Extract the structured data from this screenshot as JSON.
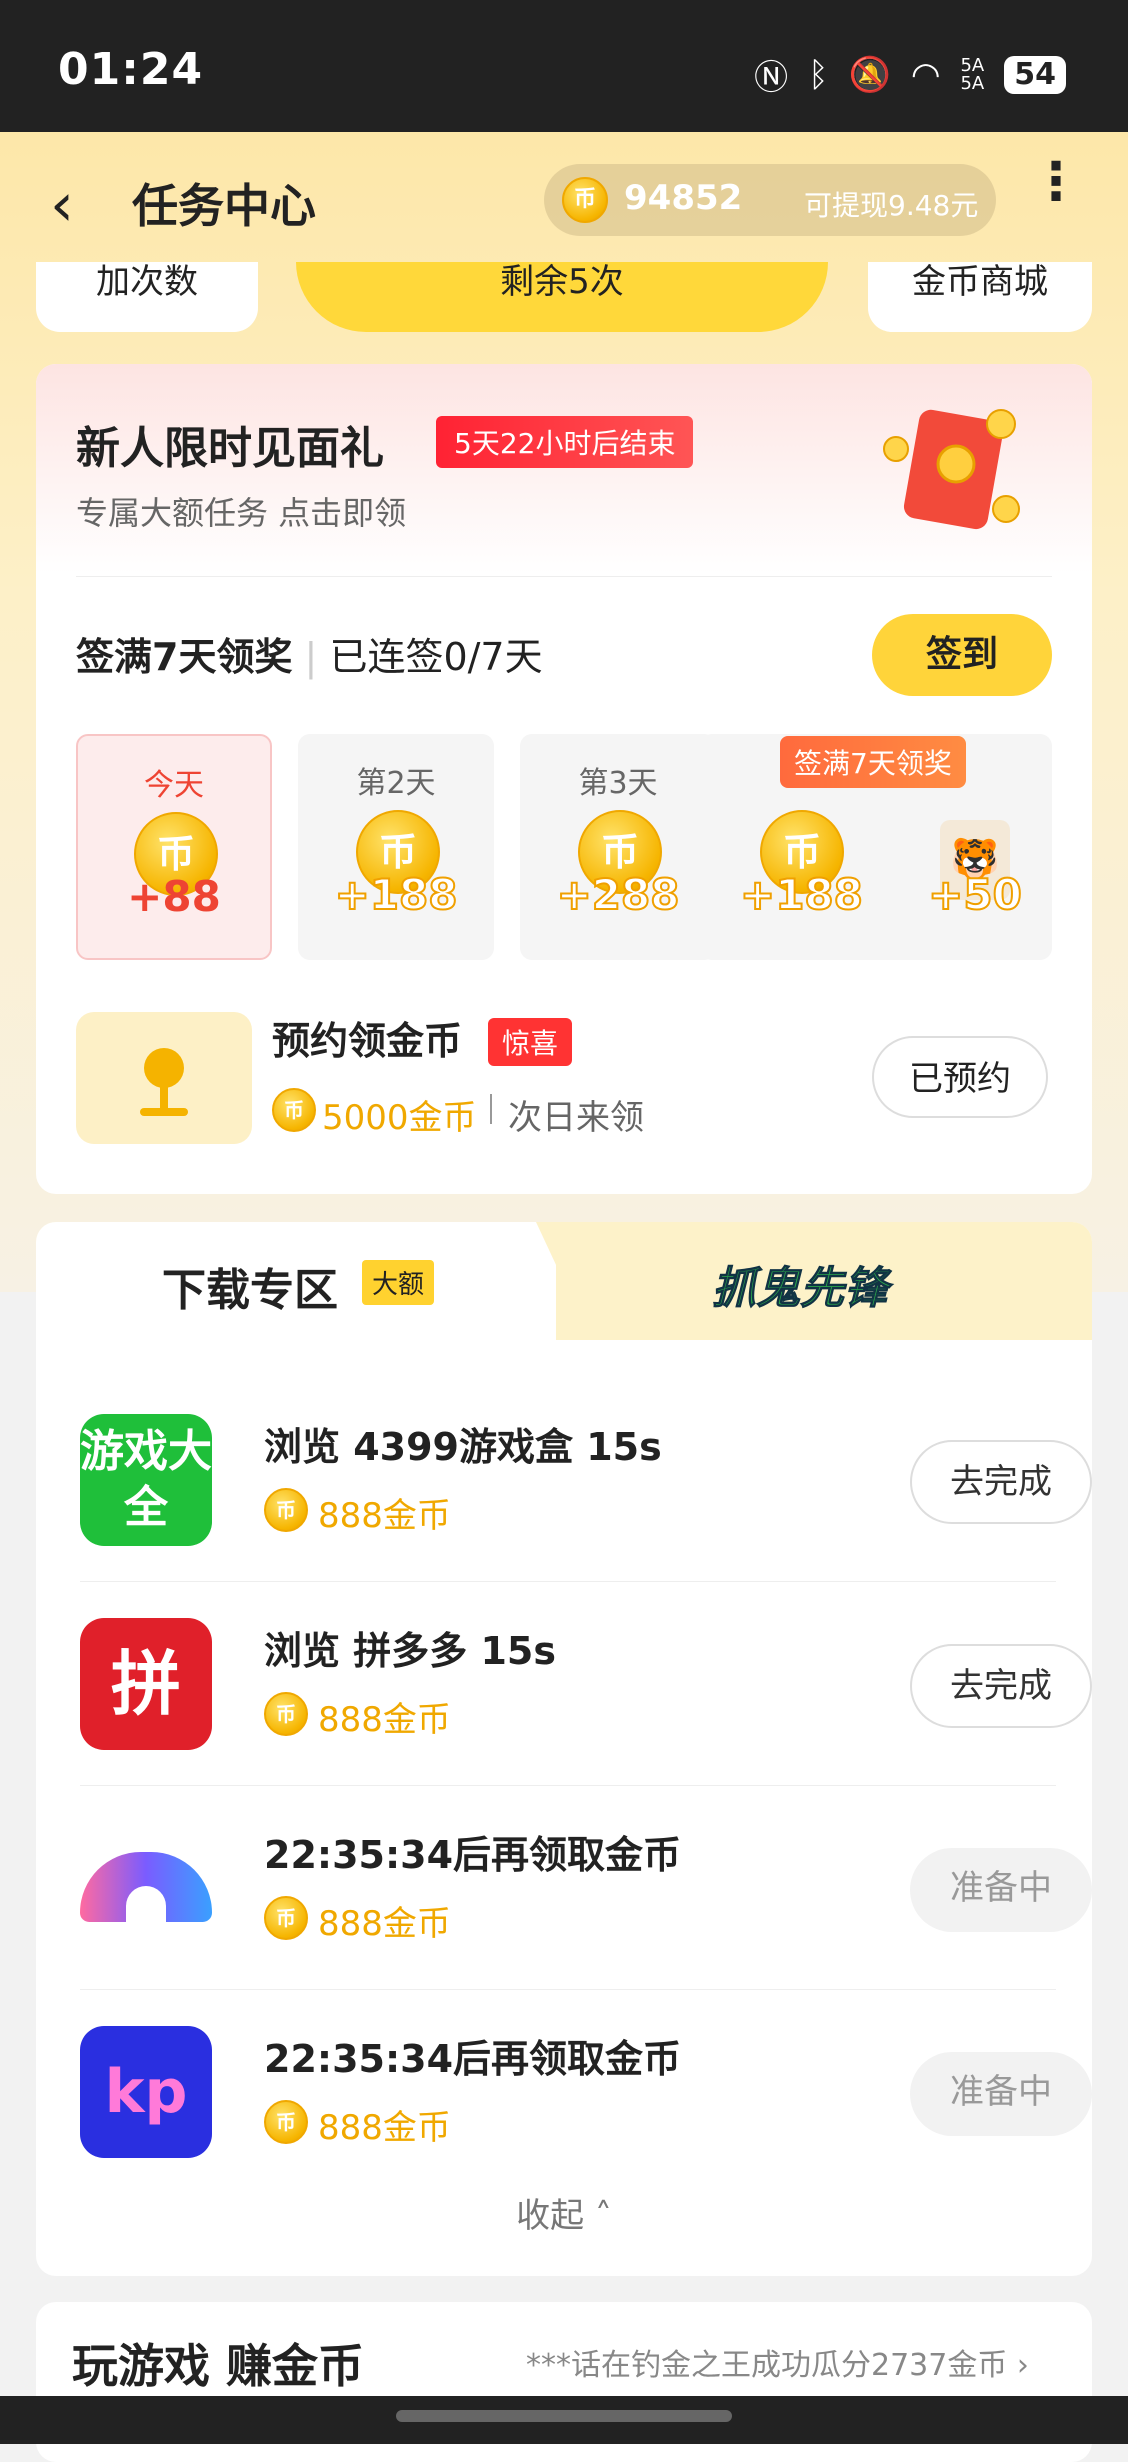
{
  "status_bar": {
    "time": "01:24",
    "icons": [
      "nfc-icon",
      "bluetooth-icon",
      "mute-icon",
      "wifi-icon",
      "signal-icon"
    ],
    "net": "5A",
    "battery": "54"
  },
  "header": {
    "title": "任务中心",
    "coins": "94852",
    "withdraw": "可提现9.48元"
  },
  "strip": {
    "left": "加次数",
    "middle": "剩余5次",
    "right": "金币商城"
  },
  "gift": {
    "title": "新人限时见面礼",
    "badge": "5天22小时后结束",
    "subtitle": "专属大额任务 点击即领"
  },
  "signin": {
    "title": "签满7天领奖",
    "progress": "已连签0/7天",
    "button": "签到",
    "days": [
      {
        "label": "今天",
        "amount": "+88"
      },
      {
        "label": "第2天",
        "amount": "+188"
      },
      {
        "label": "第3天",
        "amount": "+288"
      },
      {
        "label": "签满7天领奖",
        "amount": "+188",
        "bonus": "+50"
      }
    ]
  },
  "reserve": {
    "title": "预约领金币",
    "badge": "惊喜",
    "amount": "5000金币",
    "when": "次日来领",
    "button": "已预约"
  },
  "download": {
    "tab_title": "下载专区",
    "tab_badge": "大额",
    "other_tab": "抓鬼先锋",
    "tasks": [
      {
        "title": "浏览 4399游戏盒 15s",
        "amount": "888金币",
        "button": "去完成",
        "icon_text": "游戏大全"
      },
      {
        "title": "浏览 拼多多 15s",
        "amount": "888金币",
        "button": "去完成",
        "icon_text": "拼"
      },
      {
        "title": "22:35:34后再领取金币",
        "amount": "888金币",
        "button": "准备中"
      },
      {
        "title": "22:35:34后再领取金币",
        "amount": "888金币",
        "button": "准备中",
        "icon_text": "kp"
      }
    ],
    "collapse": "收起"
  },
  "games": {
    "title": "玩游戏 赚金币",
    "ticker": "***话在钓金之王成功瓜分2737金币"
  },
  "coin_glyph": "币"
}
